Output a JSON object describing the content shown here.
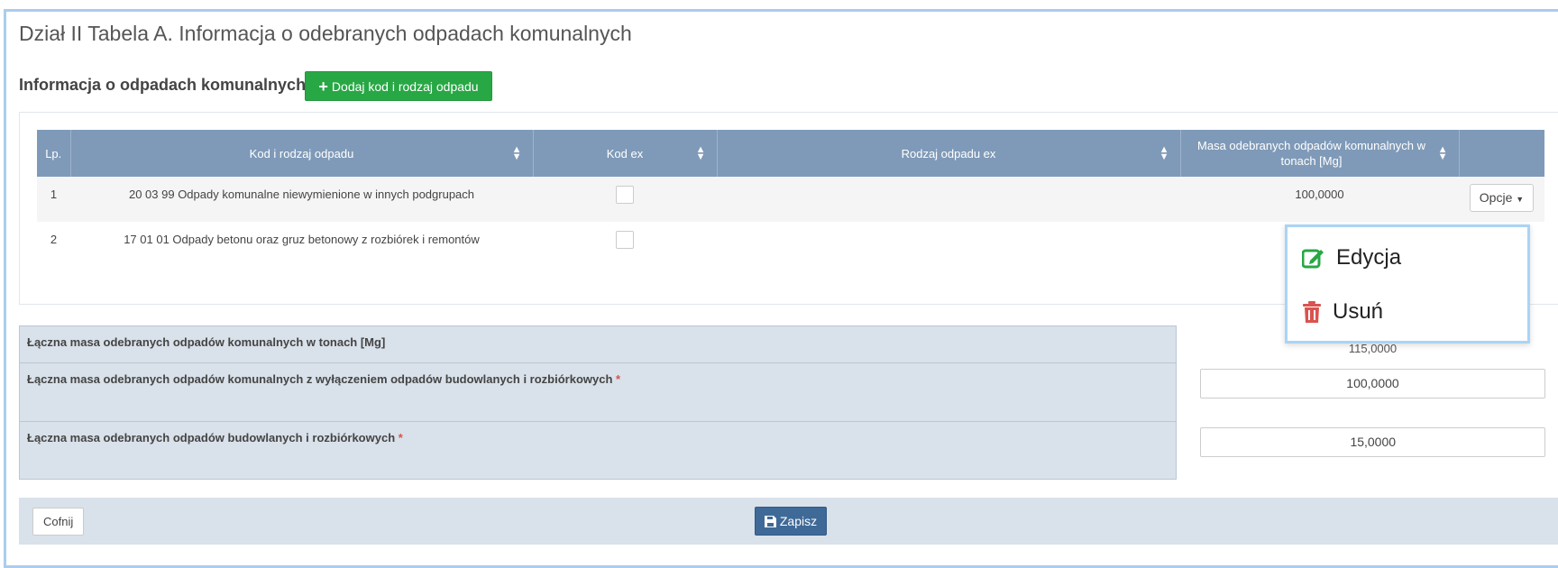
{
  "page": {
    "title": "Dział II Tabela A. Informacja o odebranych odpadach komunalnych",
    "section_title": "Informacja o odpadach komunalnych",
    "add_button_label": "Dodaj kod i rodzaj odpadu"
  },
  "table": {
    "headers": {
      "lp": "Lp.",
      "kod": "Kod i rodzaj odpadu",
      "kod_ex": "Kod ex",
      "rodzaj_ex": "Rodzaj odpadu ex",
      "masa_line1": "Masa odebranych odpadów komunalnych w",
      "masa_line2": "tonach [Mg]"
    },
    "rows": [
      {
        "lp": "1",
        "kod": "20 03 99 Odpady komunalne niewymienione w innych podgrupach",
        "rodzaj_ex": "",
        "masa": "100,0000",
        "options_label": "Opcje"
      },
      {
        "lp": "2",
        "kod": "17 01 01 Odpady betonu oraz gruz betonowy z rozbiórek i remontów",
        "rodzaj_ex": "",
        "masa": ""
      }
    ]
  },
  "dropdown": {
    "edit_label": "Edycja",
    "delete_label": "Usuń"
  },
  "summary": {
    "total_label": "Łączna masa odebranych odpadów komunalnych w tonach [Mg]",
    "total_value": "115,0000",
    "excl_label": "Łączna masa odebranych odpadów komunalnych z wyłączeniem odpadów budowlanych i rozbiórkowych",
    "excl_value": "100,0000",
    "build_label": "Łączna masa odebranych odpadów budowlanych i rozbiórkowych",
    "build_value": "15,0000",
    "required_mark": "*"
  },
  "footer": {
    "back_label": "Cofnij",
    "save_label": "Zapisz"
  },
  "colors": {
    "header_bg": "#7f9ab8",
    "add_button": "#28a745",
    "save_button": "#3f6a97",
    "label_bg": "#d9e1ea",
    "edit_icon": "#28a745",
    "delete_icon": "#d9534f"
  },
  "icons": {
    "add": "plus-icon",
    "sort": "sort-icon",
    "edit": "edit-icon",
    "delete": "trash-icon",
    "save": "floppy-icon",
    "caret": "caret-down-icon"
  }
}
